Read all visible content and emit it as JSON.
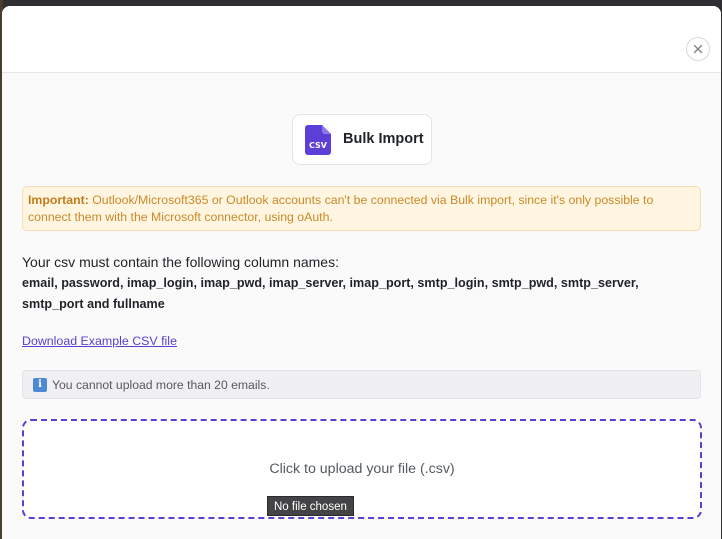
{
  "modal": {
    "close_icon": "close-icon"
  },
  "title_card": {
    "icon": "csv-file-icon",
    "icon_text": "CSV",
    "icon_color": "#5b3fd6",
    "title": "Bulk Import"
  },
  "warning": {
    "label": "Important:",
    "message": " Outlook/Microsoft365 or Outlook accounts can't be connected via Bulk import, since it's only possible to connect them with the Microsoft connector, using oAuth.",
    "color": "#c98a2a",
    "background": "#fff5e1"
  },
  "columns": {
    "intro": "Your csv must contain the following column names:",
    "list": "email, password, imap_login, imap_pwd, imap_server, imap_port, smtp_login, smtp_pwd, smtp_server, smtp_port and fullname"
  },
  "download_link": {
    "label": "Download Example CSV file",
    "color": "#5a3fd0"
  },
  "info": {
    "icon": "info-icon",
    "glyph": "i",
    "message": "You cannot upload more than 20 emails."
  },
  "upload": {
    "prompt": "Click to upload your file (.csv)",
    "file_status": "No file chosen",
    "border_color": "#5a3fd0"
  }
}
